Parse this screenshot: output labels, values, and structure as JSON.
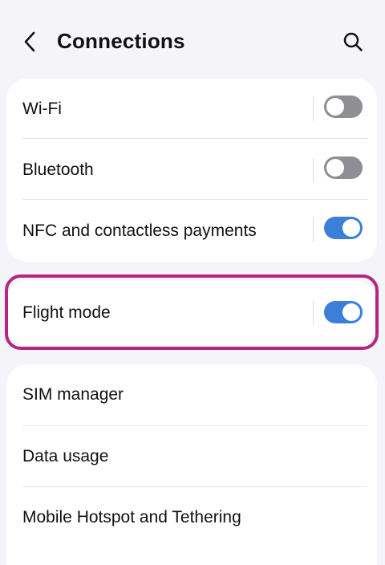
{
  "header": {
    "title": "Connections",
    "back_icon": "chevron-left-icon",
    "search_icon": "search-icon"
  },
  "colors": {
    "background": "#f5f4f8",
    "card": "#ffffff",
    "toggle_on": "#3b7fd9",
    "toggle_off": "#8e8e93",
    "highlight": "#b3287e"
  },
  "settings": {
    "wifi": {
      "label": "Wi-Fi",
      "toggle": "off"
    },
    "bluetooth": {
      "label": "Bluetooth",
      "toggle": "off"
    },
    "nfc": {
      "label": "NFC and contactless payments",
      "toggle": "on"
    },
    "flight_mode": {
      "label": "Flight mode",
      "toggle": "on",
      "highlighted": true
    },
    "sim_manager": {
      "label": "SIM manager"
    },
    "data_usage": {
      "label": "Data usage"
    },
    "hotspot": {
      "label": "Mobile Hotspot and Tethering"
    }
  }
}
